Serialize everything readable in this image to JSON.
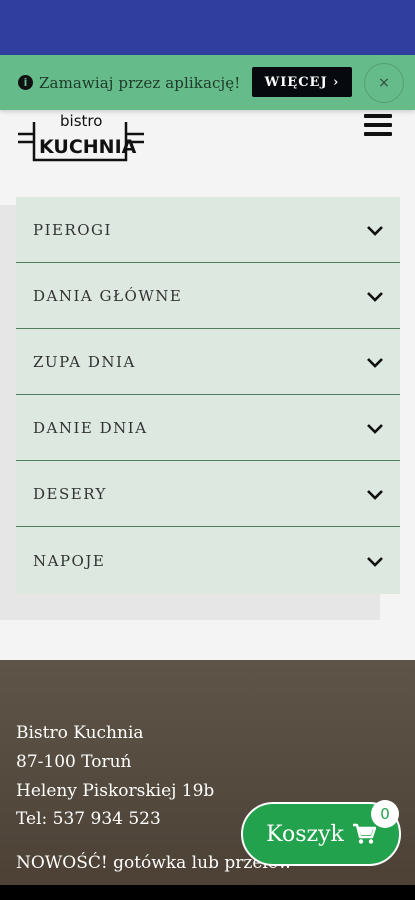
{
  "banner": {
    "text": "Zamawiaj przez aplikację!",
    "more_label": "WIĘCEJ ›",
    "close_label": "×"
  },
  "logo": {
    "line1": "bistro",
    "line2": "KUCHNIA"
  },
  "menu": {
    "items": [
      {
        "label": "PIEROGI"
      },
      {
        "label": "DANIA GŁÓWNE"
      },
      {
        "label": "ZUPA DNIA"
      },
      {
        "label": "DANIE DNIA"
      },
      {
        "label": "DESERY"
      },
      {
        "label": "NAPOJE"
      }
    ]
  },
  "footer": {
    "name": "Bistro Kuchnia",
    "city": "87-100 Toruń",
    "street": "Heleny Piskorskiej 19b",
    "phone": "Tel: 537 934 523",
    "notice": "NOWOŚĆ! gotówka lub przelew"
  },
  "cart": {
    "label": "Koszyk",
    "count": "0"
  },
  "colors": {
    "status_bar": "#303f9f",
    "banner": "#66bb8a",
    "accent_green": "#23a24d",
    "menu_bg": "#dde8e1"
  },
  "icons": [
    "info-icon",
    "close-icon",
    "menu-icon",
    "chevron-down-icon",
    "cart-icon"
  ]
}
